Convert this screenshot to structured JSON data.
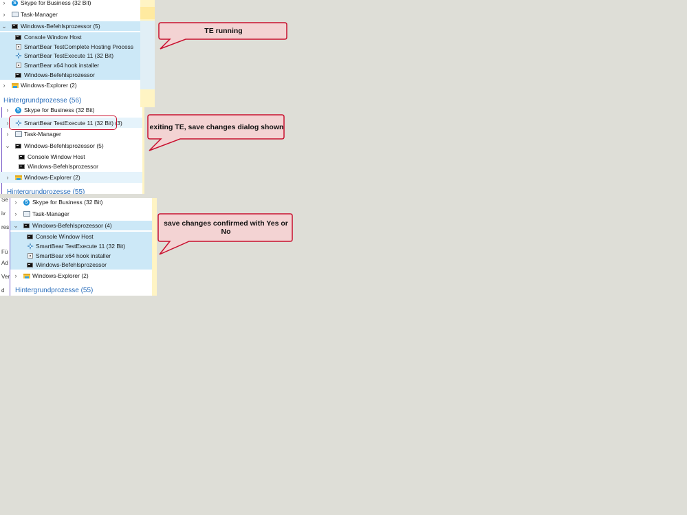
{
  "panel1": {
    "rows": [
      {
        "label": "Skype for Business (32 Bit)",
        "icon": "skype-icon",
        "expandable": true
      },
      {
        "label": "Task-Manager",
        "icon": "task-manager-icon",
        "expandable": true
      },
      {
        "label": "Windows-Befehlsprozessor (5)",
        "icon": "cmd-icon",
        "expanded": true
      },
      {
        "label": "Console Window Host",
        "icon": "cmd-icon"
      },
      {
        "label": "SmartBear TestComplete Hosting Process",
        "icon": "exe-icon"
      },
      {
        "label": "SmartBear TestExecute 11 (32 Bit)",
        "icon": "testexecute-icon"
      },
      {
        "label": "SmartBear x64 hook installer",
        "icon": "exe-icon"
      },
      {
        "label": "Windows-Befehlsprozessor",
        "icon": "cmd-icon"
      },
      {
        "label": "Windows-Explorer (2)",
        "icon": "explorer-icon",
        "expandable": true
      }
    ],
    "section": "Hintergrundprozesse (56)",
    "callout": "TE running"
  },
  "panel2": {
    "rows": [
      {
        "label": "Skype for Business (32 Bit)",
        "icon": "skype-icon"
      },
      {
        "label": "SmartBear TestExecute 11 (32 Bit) (3)",
        "icon": "testexecute-icon",
        "expandable": true
      },
      {
        "label": "Task-Manager",
        "icon": "task-manager-icon",
        "expandable": true
      },
      {
        "label": "Windows-Befehlsprozessor (5)",
        "icon": "cmd-icon",
        "expanded": true
      },
      {
        "label": "Console Window Host",
        "icon": "cmd-icon"
      },
      {
        "label": "Windows-Befehlsprozessor",
        "icon": "cmd-icon"
      },
      {
        "label": "Windows-Explorer (2)",
        "icon": "explorer-icon",
        "expandable": true
      }
    ],
    "section": "Hintergrundprozesse (55)",
    "callout": "exiting TE, save changes dialog shown"
  },
  "panel3": {
    "rows": [
      {
        "label": "Skype for Business (32 Bit)",
        "icon": "skype-icon",
        "expandable": true
      },
      {
        "label": "Task-Manager",
        "icon": "task-manager-icon",
        "expandable": true
      },
      {
        "label": "Windows-Befehlsprozessor (4)",
        "icon": "cmd-icon",
        "expanded": true
      },
      {
        "label": "Console Window Host",
        "icon": "cmd-icon"
      },
      {
        "label": "SmartBear TestExecute 11 (32 Bit)",
        "icon": "testexecute-icon"
      },
      {
        "label": "SmartBear x64 hook installer",
        "icon": "exe-icon"
      },
      {
        "label": "Windows-Befehlsprozessor",
        "icon": "cmd-icon"
      },
      {
        "label": "Windows-Explorer (2)",
        "icon": "explorer-icon",
        "expandable": true
      }
    ],
    "section": "Hintergrundprozesse (55)",
    "callout": "save changes confirmed with Yes or No",
    "left_edge_fragments": [
      "Se",
      "iv",
      "res",
      "Fü",
      "Ad",
      "Ver",
      "d"
    ]
  },
  "colors": {
    "selected_row": "#cce8f7",
    "section_text": "#2a6ebb",
    "callout_fill": "#f3d3d3",
    "callout_border": "#c8102e",
    "background": "#deded7"
  }
}
